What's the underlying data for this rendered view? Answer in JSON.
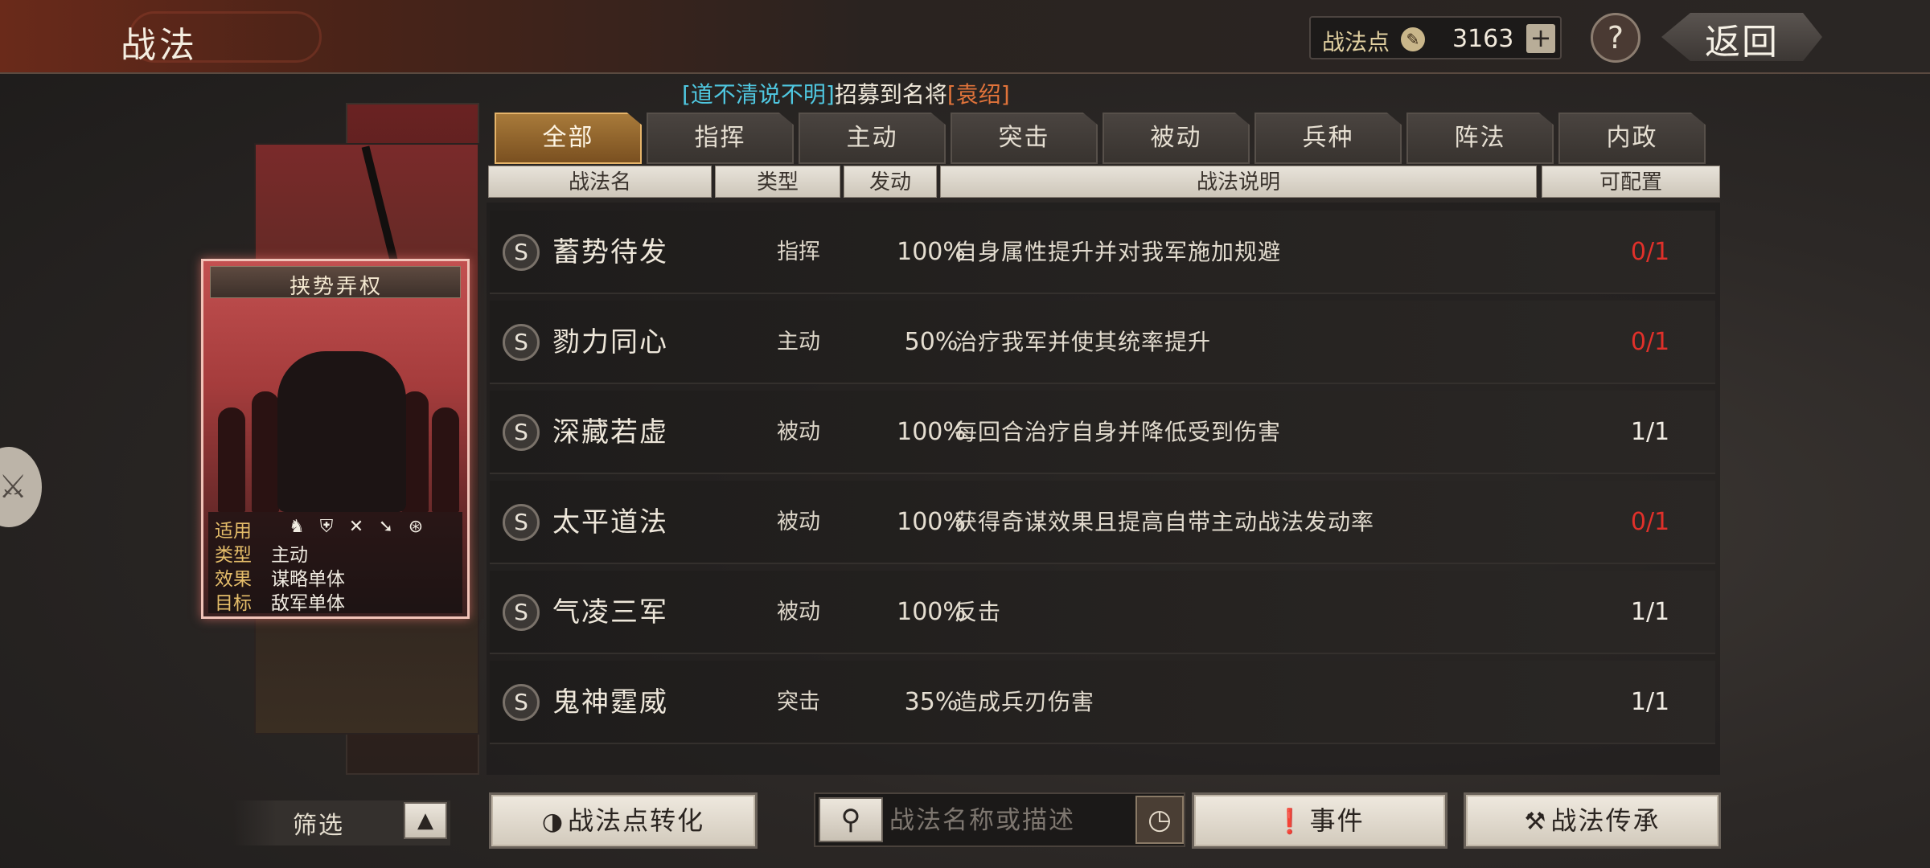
{
  "header": {
    "title": "战法",
    "points_label": "战法点",
    "points_value": "3163",
    "plus_label": "+",
    "help_label": "?",
    "back_label": "返回"
  },
  "notice": {
    "part1": "[道不清说不明]",
    "part2": "招募到名将",
    "part3": "[袁绍]"
  },
  "card": {
    "title": "挟势弄权",
    "info": [
      {
        "key": "适用",
        "value": ""
      },
      {
        "key": "类型",
        "value": "主动"
      },
      {
        "key": "效果",
        "value": "谋略单体"
      },
      {
        "key": "目标",
        "value": "敌军单体"
      }
    ],
    "troop_icons": [
      "cavalry-icon",
      "shield-icon",
      "bow-icon",
      "spear-icon",
      "siege-icon"
    ]
  },
  "tabs": [
    {
      "label": "全部",
      "active": true
    },
    {
      "label": "指挥",
      "active": false
    },
    {
      "label": "主动",
      "active": false
    },
    {
      "label": "突击",
      "active": false
    },
    {
      "label": "被动",
      "active": false
    },
    {
      "label": "兵种",
      "active": false
    },
    {
      "label": "阵法",
      "active": false
    },
    {
      "label": "内政",
      "active": false
    }
  ],
  "columns": {
    "name": "战法名",
    "type": "类型",
    "rate": "发动",
    "desc": "战法说明",
    "conf": "可配置"
  },
  "rows": [
    {
      "grade": "S",
      "name": "蓄势待发",
      "type": "指挥",
      "rate": "100%",
      "desc": "自身属性提升并对我军施加规避",
      "conf": "0/1",
      "conf_color": "red"
    },
    {
      "grade": "S",
      "name": "勠力同心",
      "type": "主动",
      "rate": "50%",
      "desc": "治疗我军并使其统率提升",
      "conf": "0/1",
      "conf_color": "red"
    },
    {
      "grade": "S",
      "name": "深藏若虚",
      "type": "被动",
      "rate": "100%",
      "desc": "每回合治疗自身并降低受到伤害",
      "conf": "1/1",
      "conf_color": "white"
    },
    {
      "grade": "S",
      "name": "太平道法",
      "type": "被动",
      "rate": "100%",
      "desc": "获得奇谋效果且提高自带主动战法发动率",
      "conf": "0/1",
      "conf_color": "red"
    },
    {
      "grade": "S",
      "name": "气凌三军",
      "type": "被动",
      "rate": "100%",
      "desc": "反击",
      "conf": "1/1",
      "conf_color": "white"
    },
    {
      "grade": "S",
      "name": "鬼神霆威",
      "type": "突击",
      "rate": "35%",
      "desc": "造成兵刃伤害",
      "conf": "1/1",
      "conf_color": "white"
    }
  ],
  "footer": {
    "filter_label": "筛选",
    "convert_label": "战法点转化",
    "search_placeholder": "战法名称或描述",
    "events_label": "事件",
    "inherit_label": "战法传承"
  }
}
